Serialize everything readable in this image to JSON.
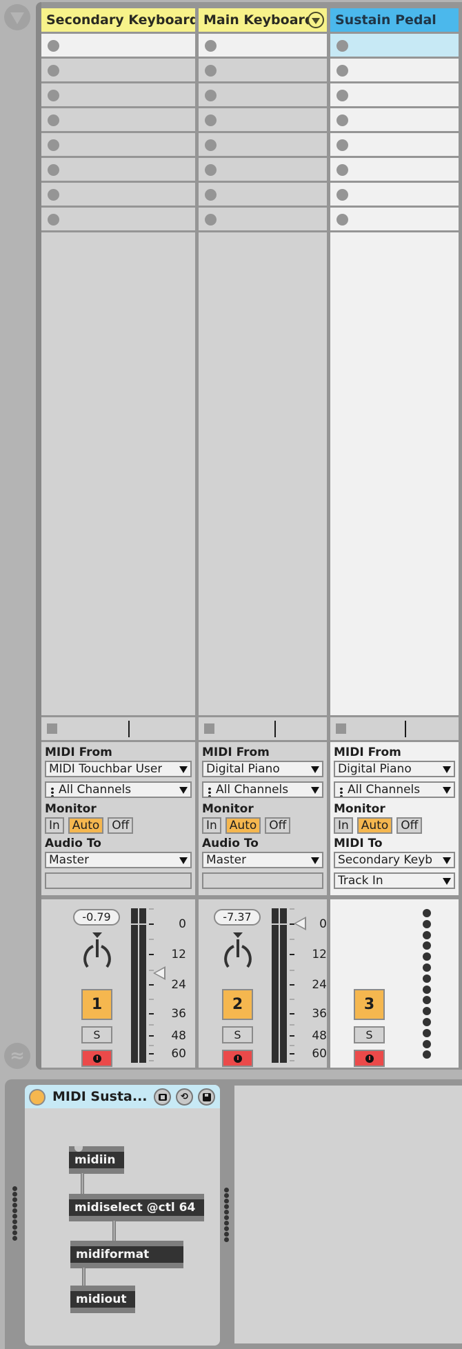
{
  "gutter": {
    "top_button_icon": "triangle-down-icon",
    "bottom_button_icon": "wave-icon",
    "wave_glyph": "≈"
  },
  "tracks": [
    {
      "name": "Secondary Keyboard",
      "color": "#f7f28a",
      "has_fold_button": false,
      "clip_slots": 8,
      "io": {
        "input_label": "MIDI From",
        "input_value": "MIDI Touchbar User",
        "channel_value": "All Channels",
        "monitor_label": "Monitor",
        "monitor_options": [
          "In",
          "Auto",
          "Off"
        ],
        "monitor_selected": "Auto",
        "output_label": "Audio To",
        "output_value": "Master",
        "output_sub_value": ""
      },
      "mixer": {
        "volume_readout": "-0.79",
        "volume_db": -0.79,
        "track_number": "1",
        "solo_label": "S",
        "arm_icon": "record-arm-icon"
      }
    },
    {
      "name": "Main Keyboard",
      "color": "#f7f28a",
      "has_fold_button": true,
      "clip_slots": 8,
      "io": {
        "input_label": "MIDI From",
        "input_value": "Digital Piano",
        "channel_value": "All Channels",
        "monitor_label": "Monitor",
        "monitor_options": [
          "In",
          "Auto",
          "Off"
        ],
        "monitor_selected": "Auto",
        "output_label": "Audio To",
        "output_value": "Master",
        "output_sub_value": ""
      },
      "mixer": {
        "volume_readout": "-7.37",
        "volume_db": -7.37,
        "track_number": "2",
        "solo_label": "S",
        "arm_icon": "record-arm-icon"
      }
    },
    {
      "name": "Sustain Pedal",
      "color": "#4bb8ec",
      "has_fold_button": false,
      "clip_slots": 8,
      "io": {
        "input_label": "MIDI From",
        "input_value": "Digital Piano",
        "channel_value": "All Channels",
        "monitor_label": "Monitor",
        "monitor_options": [
          "In",
          "Auto",
          "Off"
        ],
        "monitor_selected": "Auto",
        "output_label": "MIDI To",
        "output_value": "Secondary Keyb",
        "output_sub_value": "Track In"
      },
      "mixer": {
        "track_number": "3",
        "solo_label": "S",
        "arm_icon": "record-arm-icon"
      }
    }
  ],
  "meter_scale": [
    "0",
    "12",
    "24",
    "36",
    "48",
    "60"
  ],
  "device": {
    "name": "MIDI Susta...",
    "title_color": "#c7e9f5",
    "on_color": "#f5b74f",
    "buttons": [
      "map-icon",
      "hot-swap-icon",
      "save-icon"
    ],
    "patch_objects": [
      {
        "text": "midiin"
      },
      {
        "text": "midiselect @ctl 64"
      },
      {
        "text": "midiformat"
      },
      {
        "text": "midiout"
      }
    ]
  },
  "colors": {
    "monitor_active": "#f5b74f",
    "arm_red": "#eb4a4a",
    "track_number_bg": "#f5b74f"
  }
}
